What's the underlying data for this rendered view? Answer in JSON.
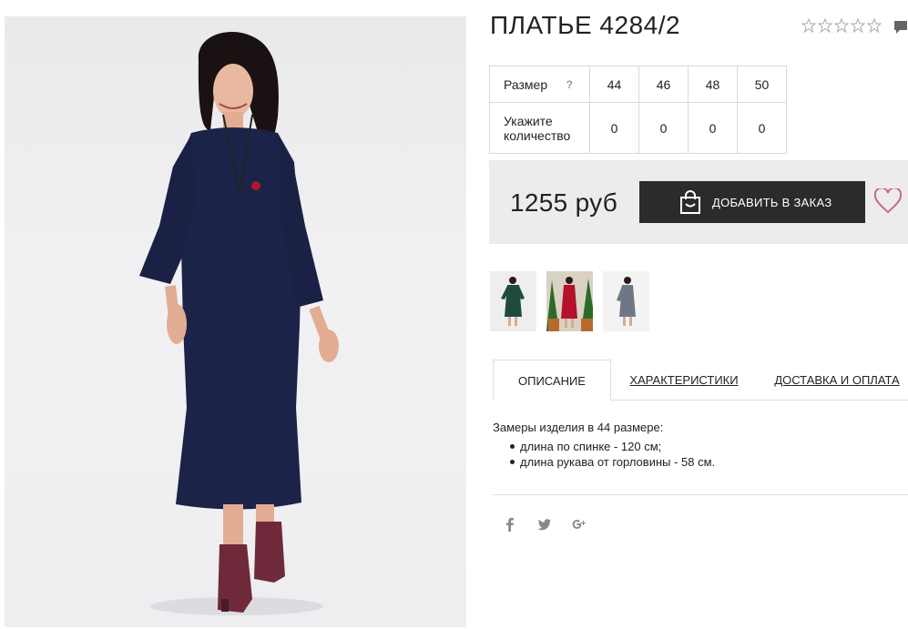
{
  "product": {
    "title": "ПЛАТЬЕ 4284/2",
    "rating": 0,
    "rating_max": 5,
    "image_alt": "dress-photo"
  },
  "sizes": {
    "label": "Размер",
    "help": "?",
    "values": [
      "44",
      "46",
      "48",
      "50"
    ],
    "qty_label_line1": "Укажите",
    "qty_label_line2": "количество",
    "quantities": [
      "0",
      "0",
      "0",
      "0"
    ]
  },
  "purchase": {
    "price": "1255 руб",
    "add_button_label": "ДОБАВИТЬ В ЗАКАЗ"
  },
  "thumbnails": [
    {
      "name": "thumb-green-dress",
      "color": "#1f4a3d"
    },
    {
      "name": "thumb-red-dress",
      "color": "#b3122a"
    },
    {
      "name": "thumb-grey-dress",
      "color": "#6f7787"
    }
  ],
  "tabs": {
    "description": "ОПИСАНИЕ",
    "specs": "ХАРАКТЕРИСТИКИ",
    "delivery": "ДОСТАВКА И ОПЛАТА"
  },
  "description": {
    "intro": "Замеры изделия в 44 размере:",
    "items": [
      "длина по спинке - 120 см;",
      "длина рукава от горловины - 58 см."
    ]
  },
  "social": [
    "facebook-icon",
    "twitter-icon",
    "google-plus-icon"
  ],
  "colors": {
    "dress": "#1c2348",
    "button_bg": "#2b2b2b",
    "heart": "#c86a83",
    "price_bg": "#ececec"
  }
}
